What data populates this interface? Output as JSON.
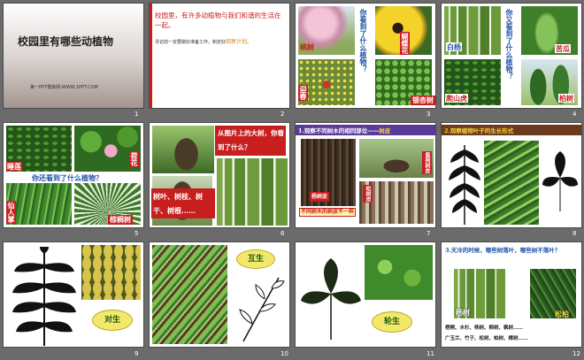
{
  "slides": [
    {
      "num": "1",
      "title": "校园里有哪些动植物",
      "footer": "第一PPT模板网-WWW.1PPT.COM"
    },
    {
      "num": "2",
      "text1": "校园里，有许多动植物与我们和谐的生活在一起。",
      "text2a": "寻访前一定要做好准备工作，制定好",
      "text2b": "观察计划",
      "text2c": "。"
    },
    {
      "num": "3",
      "question": "你看到了什么植物？",
      "labels": [
        "桃树",
        "蝴蝶花",
        "迎春",
        "银杏树"
      ]
    },
    {
      "num": "4",
      "question": "你又看到了什么植物？",
      "labels": [
        "白杨",
        "苦瓜",
        "爬山虎",
        "柏树"
      ]
    },
    {
      "num": "5",
      "question": "你还看到了什么植物？",
      "labels": [
        "睡莲",
        "荷花",
        "仙人掌",
        "棕榈树"
      ]
    },
    {
      "num": "6",
      "bubble": "从图片上的大树，你看到了什么？",
      "answer": "树叶、树枝、树干、树根……"
    },
    {
      "num": "7",
      "title": "1.观察不同树木的相同部位——",
      "title_hl": "树皮",
      "labels": [
        "杨树皮",
        "紫荆树皮",
        "松树皮"
      ],
      "caption": "不同树木的树皮不一样"
    },
    {
      "num": "8",
      "title": "2.观察植物叶子的生长形式"
    },
    {
      "num": "9",
      "bubble": "对生"
    },
    {
      "num": "10",
      "bubble": "互生"
    },
    {
      "num": "11",
      "bubble": "轮生"
    },
    {
      "num": "12",
      "question": "3.天冷的时候，哪些树落叶，哪些树不落叶？",
      "labels": [
        "杨树",
        "松柏"
      ],
      "line1": "梧桐、水杉、杨树、柳树、枫树……",
      "line2": "广玉兰、竹子、松树、柏树、樟树……"
    }
  ],
  "colors": {
    "accent_red": "#c81e1e",
    "title_blue": "#1a5a9a",
    "bubble_yellow": "#f4e86a"
  }
}
